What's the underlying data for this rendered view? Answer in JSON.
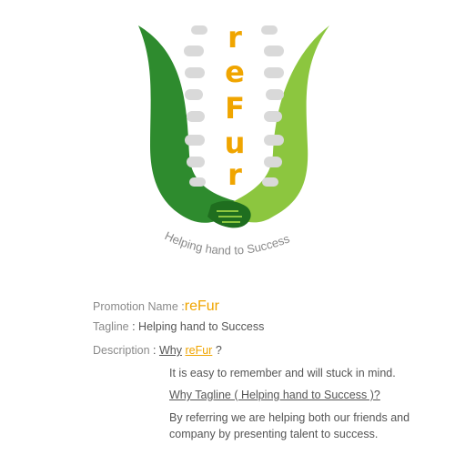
{
  "logo": {
    "letters": [
      "r",
      "e",
      "F",
      "u",
      "r"
    ],
    "arc_text": "Helping hand to Success",
    "colors": {
      "dark_green": "#2e8b2e",
      "light_green": "#8cc63f",
      "accent": "#f0a500",
      "chat_bubble": "#d9d9d9"
    }
  },
  "promotion": {
    "label": "Promotion Name",
    "sep": " :",
    "value": "reFur"
  },
  "tagline": {
    "label": "Tagline",
    "sep": "  : ",
    "value": "Helping hand to Success"
  },
  "description": {
    "label": "Description",
    "sep": "  :",
    "why_prefix": "Why",
    "why_brand": "reFur",
    "why_suffix": "?",
    "answer1": "It is easy to remember and will stuck in mind.",
    "question2": "Why Tagline ( Helping hand to Success )?",
    "answer2_line1": "By referring we are helping both our friends and",
    "answer2_line2": "company by presenting talent to success."
  }
}
